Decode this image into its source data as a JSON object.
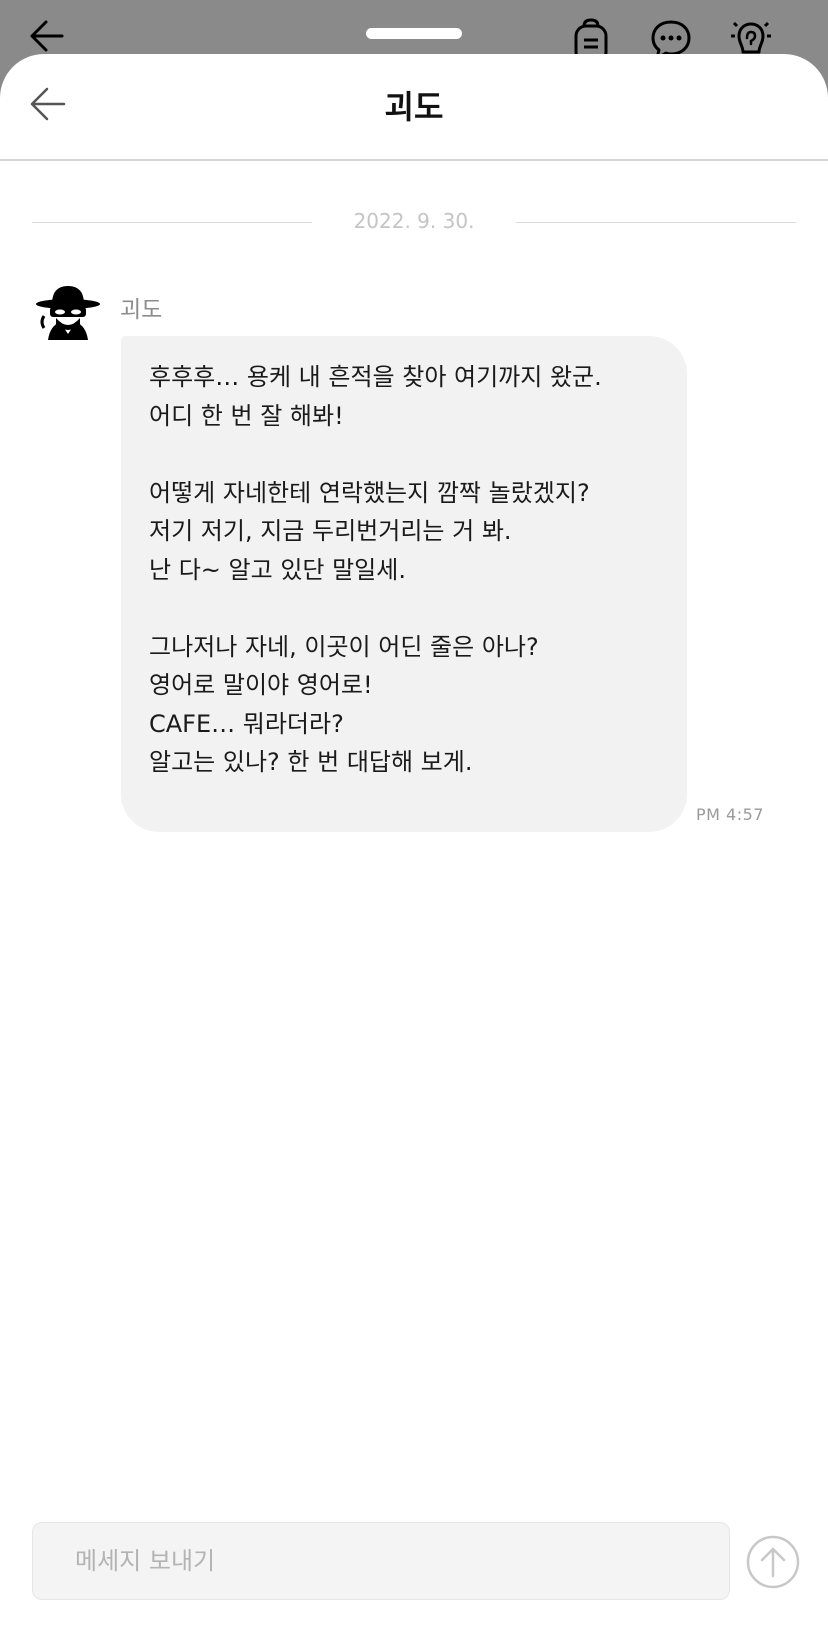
{
  "chat": {
    "title": "괴도",
    "date": "2022. 9. 30.",
    "sender_name": "괴도",
    "time": "PM  4:57",
    "message_lines": [
      "후후후… 용케 내 흔적을 찾아 여기까지 왔군.",
      "어디 한 번 잘 해봐!",
      "",
      "어떻게 자네한테 연락했는지 깜짝 놀랐겠지?",
      "저기 저기, 지금 두리번거리는 거 봐.",
      "난 다~ 알고 있단 말일세.",
      "",
      "그나저나 자네, 이곳이 어딘 줄은 아나?",
      "영어로 말이야 영어로!",
      "CAFE… 뭐라더라?",
      "알고는 있나? 한 번 대답해 보게."
    ]
  },
  "composer": {
    "placeholder": "메세지 보내기",
    "value": ""
  },
  "icons": {
    "top_back": "arrow-left-icon",
    "backpack": "backpack-icon",
    "chat": "chat-bubble-icon",
    "hint": "lightbulb-icon",
    "header_back": "arrow-left-icon",
    "avatar": "detective-avatar",
    "send": "arrow-up-circle-icon"
  },
  "colors": {
    "overlay": "#8a8a8a",
    "bubble": "#f2f2f2",
    "text": "#1a1a1a",
    "muted": "#8c8c8c"
  }
}
